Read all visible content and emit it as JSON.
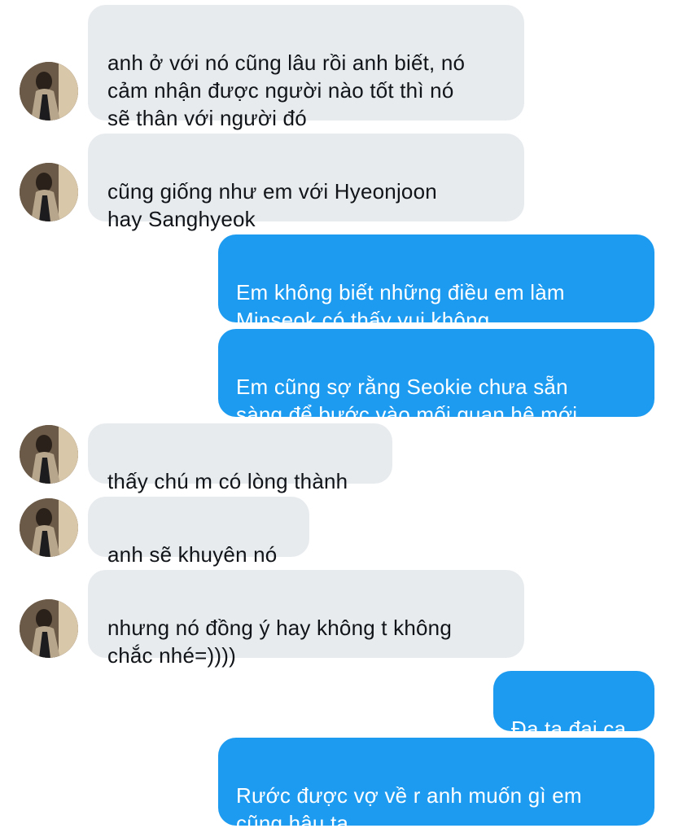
{
  "conversation": {
    "messages": [
      {
        "side": "in",
        "text": "anh ở với nó cũng lâu rồi anh biết, nó\ncảm nhận được người nào tốt thì nó\nsẽ thân với người đó",
        "has_avatar": true
      },
      {
        "side": "in",
        "text": "cũng giống như em với Hyeonjoon\nhay Sanghyeok",
        "has_avatar": true
      },
      {
        "side": "out",
        "text": "Em không biết những điều em làm\nMinseok có thấy vui không"
      },
      {
        "side": "out",
        "text": "Em cũng sợ rằng Seokie chưa sẵn\nsàng để bước vào mối quan hệ mới"
      },
      {
        "side": "in",
        "text": "thấy chú m có lòng thành",
        "has_avatar": true
      },
      {
        "side": "in",
        "text": "anh sẽ khuyên nó",
        "has_avatar": true
      },
      {
        "side": "in",
        "text": "nhưng nó đồng ý hay không t không\nchắc nhé=))))",
        "has_avatar": true
      },
      {
        "side": "out",
        "text": "Đa tạ đại ca"
      },
      {
        "side": "out",
        "text": "Rước được vợ về r anh muốn gì em\ncũng hậu tạ"
      }
    ]
  },
  "colors": {
    "incoming_bubble": "#e8ebee",
    "outgoing_bubble": "#1d9bf0",
    "incoming_text": "#111418",
    "outgoing_text": "#ffffff"
  },
  "icons": {
    "avatar": "profile-photo"
  }
}
